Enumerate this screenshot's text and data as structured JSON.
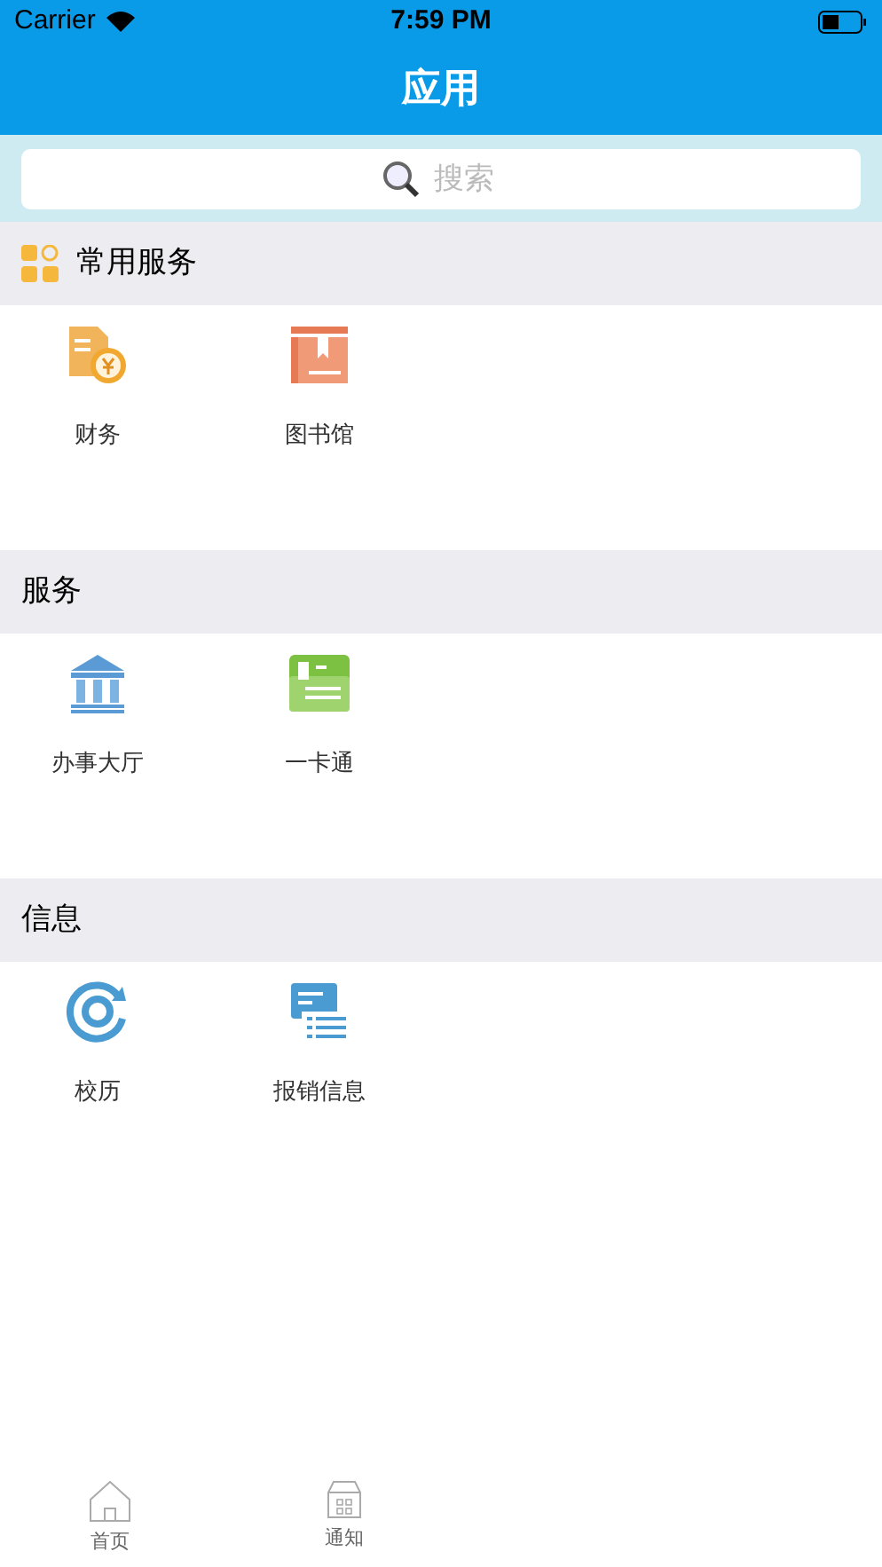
{
  "status_bar": {
    "carrier": "Carrier",
    "time": "7:59 PM"
  },
  "header": {
    "title": "应用"
  },
  "search": {
    "placeholder": "搜索"
  },
  "sections": [
    {
      "title": "常用服务",
      "has_icon": true,
      "items": [
        {
          "label": "财务",
          "kind": "finance"
        },
        {
          "label": "图书馆",
          "kind": "book"
        }
      ]
    },
    {
      "title": "服务",
      "has_icon": false,
      "items": [
        {
          "label": "办事大厅",
          "kind": "hall"
        },
        {
          "label": "一卡通",
          "kind": "card"
        }
      ]
    },
    {
      "title": "信息",
      "has_icon": false,
      "items": [
        {
          "label": "校历",
          "kind": "clock"
        },
        {
          "label": "报销信息",
          "kind": "list"
        }
      ]
    }
  ],
  "tab_bar": [
    {
      "label": "首页",
      "kind": "home"
    },
    {
      "label": "通知",
      "kind": "inbox"
    }
  ]
}
